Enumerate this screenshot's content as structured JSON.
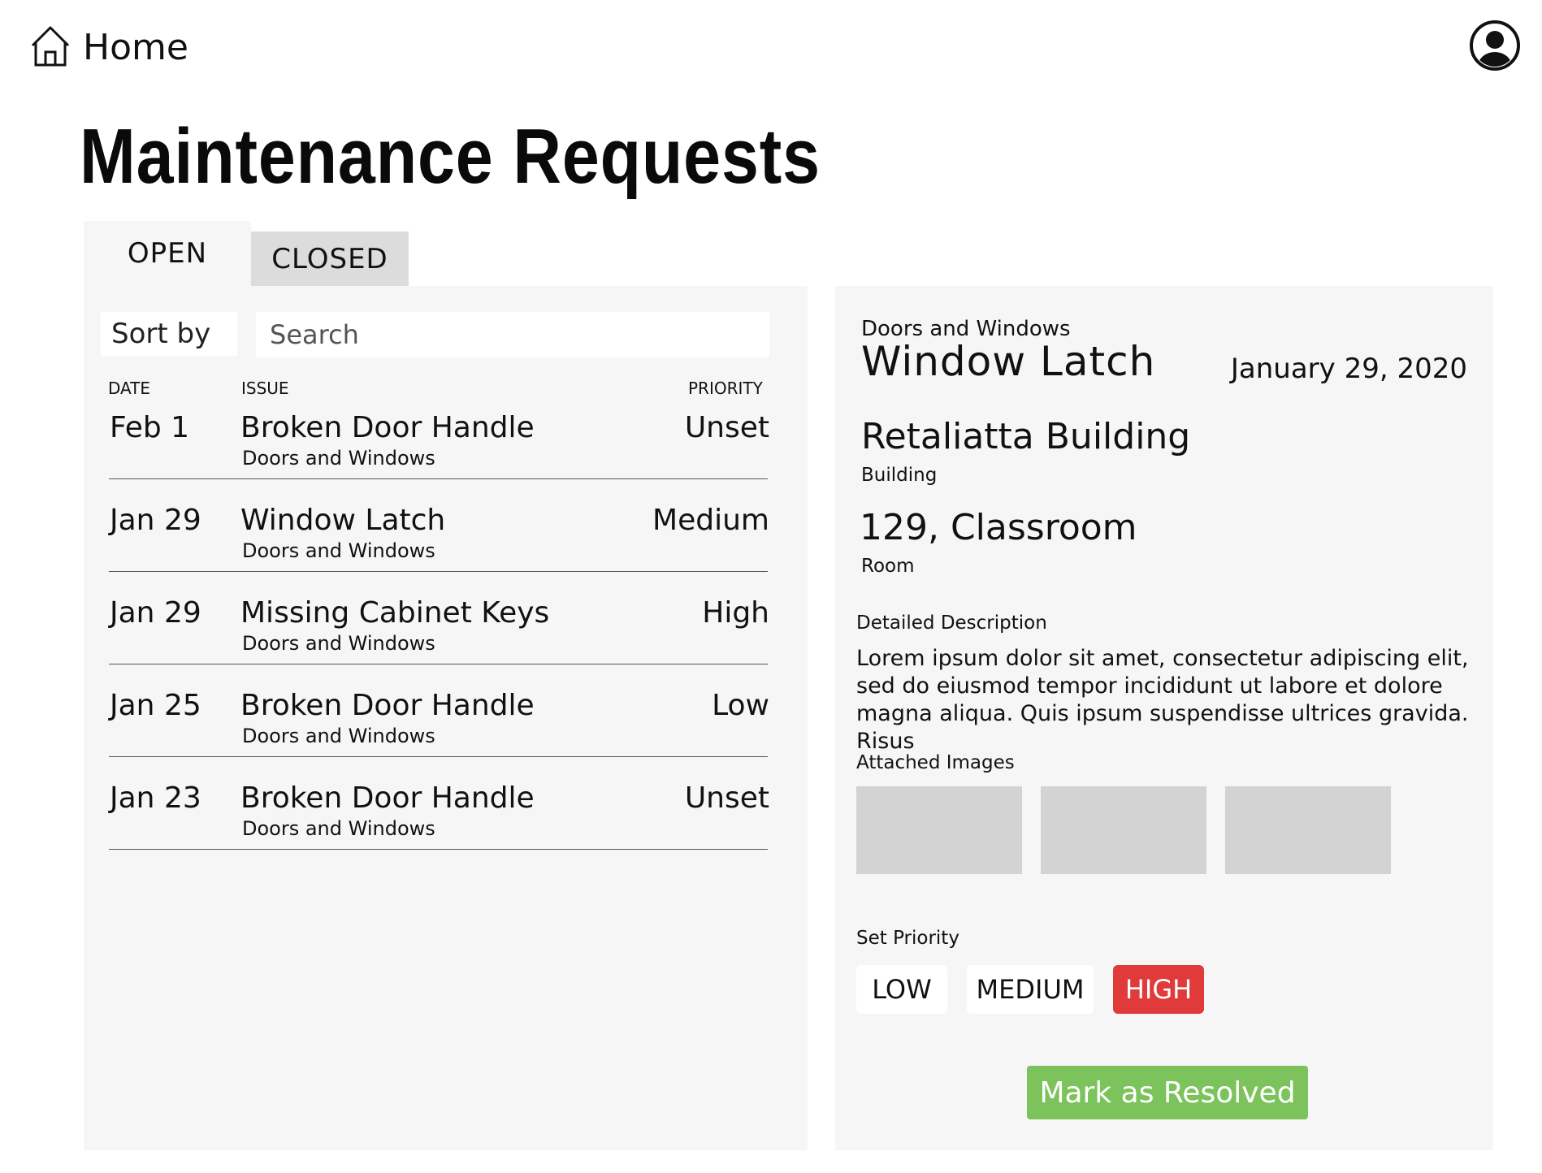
{
  "header": {
    "home_label": "Home",
    "home_icon": "home-icon",
    "avatar_icon": "user-avatar-icon",
    "page_title": "Maintenance Requests"
  },
  "tabs": [
    {
      "label": "OPEN",
      "active": true
    },
    {
      "label": "CLOSED",
      "active": false
    }
  ],
  "list": {
    "sort_label": "Sort by",
    "search_placeholder": "Search",
    "columns": {
      "date": "DATE",
      "issue": "ISSUE",
      "priority": "PRIORITY"
    },
    "rows": [
      {
        "date": "Feb 1",
        "title": "Broken Door Handle",
        "category": "Doors and Windows",
        "priority": "Unset"
      },
      {
        "date": "Jan 29",
        "title": "Window Latch",
        "category": "Doors and Windows",
        "priority": "Medium"
      },
      {
        "date": "Jan 29",
        "title": "Missing Cabinet Keys",
        "category": "Doors and Windows",
        "priority": "High"
      },
      {
        "date": "Jan 25",
        "title": "Broken Door Handle",
        "category": "Doors and Windows",
        "priority": "Low"
      },
      {
        "date": "Jan 23",
        "title": "Broken Door Handle",
        "category": "Doors and Windows",
        "priority": "Unset"
      }
    ]
  },
  "detail": {
    "category": "Doors and Windows",
    "title": "Window Latch",
    "date": "January 29, 2020",
    "building": "Retaliatta Building",
    "building_label": "Building",
    "room": "129, Classroom",
    "room_label": "Room",
    "description_label": "Detailed Description",
    "description": "Lorem ipsum dolor sit amet, consectetur adipiscing elit, sed do eiusmod tempor incididunt ut labore et dolore magna aliqua. Quis ipsum suspendisse ultrices gravida. Risus",
    "images_label": "Attached Images",
    "priority_label": "Set Priority",
    "priority_options": [
      "LOW",
      "MEDIUM",
      "HIGH"
    ],
    "selected_priority": "HIGH",
    "resolve_label": "Mark as Resolved"
  },
  "colors": {
    "panel_bg": "#f6f6f6",
    "tab_inactive_bg": "#dcdcdc",
    "thumbnail_bg": "#d3d3d3",
    "high_priority": "#e03a3a",
    "resolve_button": "#7cc35c"
  }
}
